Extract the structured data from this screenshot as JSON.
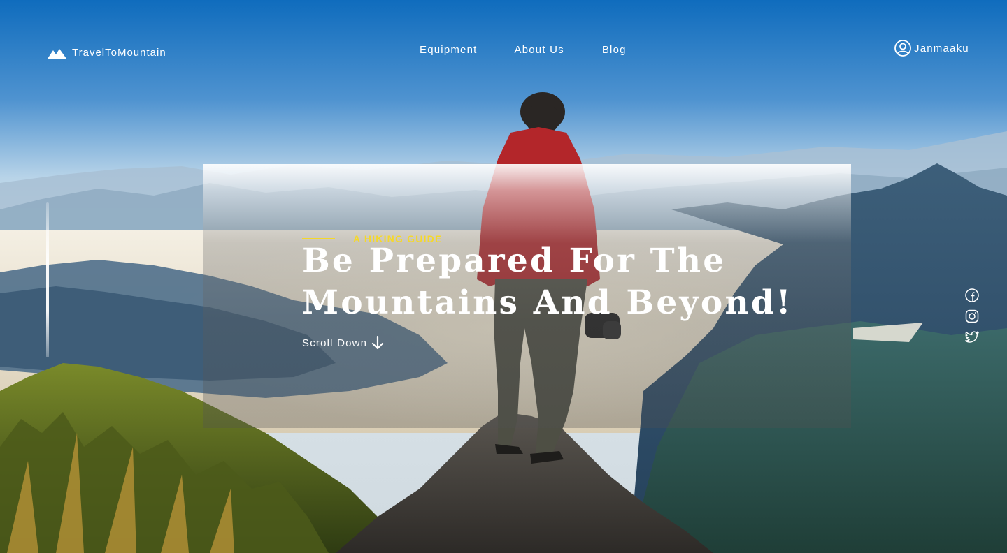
{
  "header": {
    "logo_text": "TravelToMountain",
    "nav": [
      {
        "label": "Equipment"
      },
      {
        "label": "About Us"
      },
      {
        "label": "Blog"
      }
    ],
    "user_name": "Janmaaku"
  },
  "hero": {
    "eyebrow": "A HIKING GUIDE",
    "headline_line1": "Be Prepared For The",
    "headline_line2": "Mountains And Beyond!",
    "scroll_label": "Scroll Down"
  },
  "social": {
    "icons": [
      "facebook-icon",
      "instagram-icon",
      "twitter-icon"
    ]
  },
  "colors": {
    "accent": "#f5d82a",
    "text": "#ffffff",
    "sky_top": "#0f6cbd"
  },
  "icons": {
    "logo": "mountain-icon",
    "user": "user-circle-icon",
    "scroll": "arrow-down-icon"
  }
}
